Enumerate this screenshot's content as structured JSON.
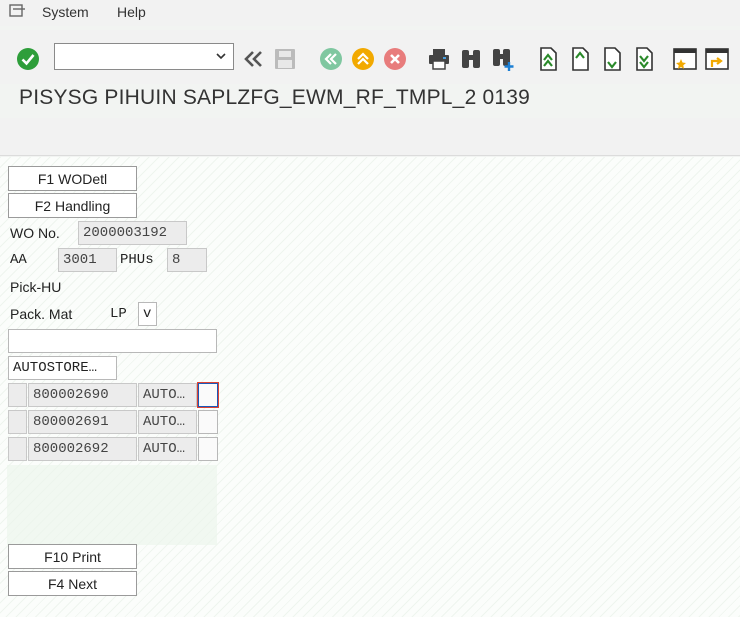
{
  "menu": {
    "system": "System",
    "help": "Help"
  },
  "toolbar": {
    "icons": [
      "enter-icon",
      "back-icon",
      "save-icon",
      "nav-back-icon",
      "exit-icon",
      "cancel-icon",
      "print-icon",
      "find-icon",
      "find-next-icon",
      "first-page-icon",
      "prev-page-icon",
      "next-page-icon",
      "last-page-icon",
      "new-session-icon",
      "shortcut-icon"
    ],
    "command_value": ""
  },
  "title": "PISYSG PIHUIN SAPLZFG_EWM_RF_TMPL_2 0139",
  "form": {
    "f1_button": "F1 WODetl",
    "f2_button": "F2 Handling",
    "wo_label": "WO No.",
    "wo_value": "2000003192",
    "aa_label": "AA",
    "aa_value": "3001",
    "phus_label": "PHUs",
    "phus_value": "8",
    "pick_hu_label": "Pick-HU",
    "pack_mat_label": "Pack. Mat",
    "pack_mat_code": "LP",
    "pack_mat_value": "v",
    "scan_value": "",
    "storage_value": "AUTOSTORE…",
    "rows": [
      {
        "hu": "800002690",
        "loc": "AUTO…"
      },
      {
        "hu": "800002691",
        "loc": "AUTO…"
      },
      {
        "hu": "800002692",
        "loc": "AUTO…"
      }
    ],
    "f10_button": "F10 Print",
    "f4_button": "F4 Next"
  },
  "colors": {
    "ok_green": "#2e9e3a",
    "nav_green": "#7fc7a0",
    "orange": "#f2a900",
    "cancel_red": "#e87c7c",
    "arrow_green": "#2a8a2a"
  }
}
